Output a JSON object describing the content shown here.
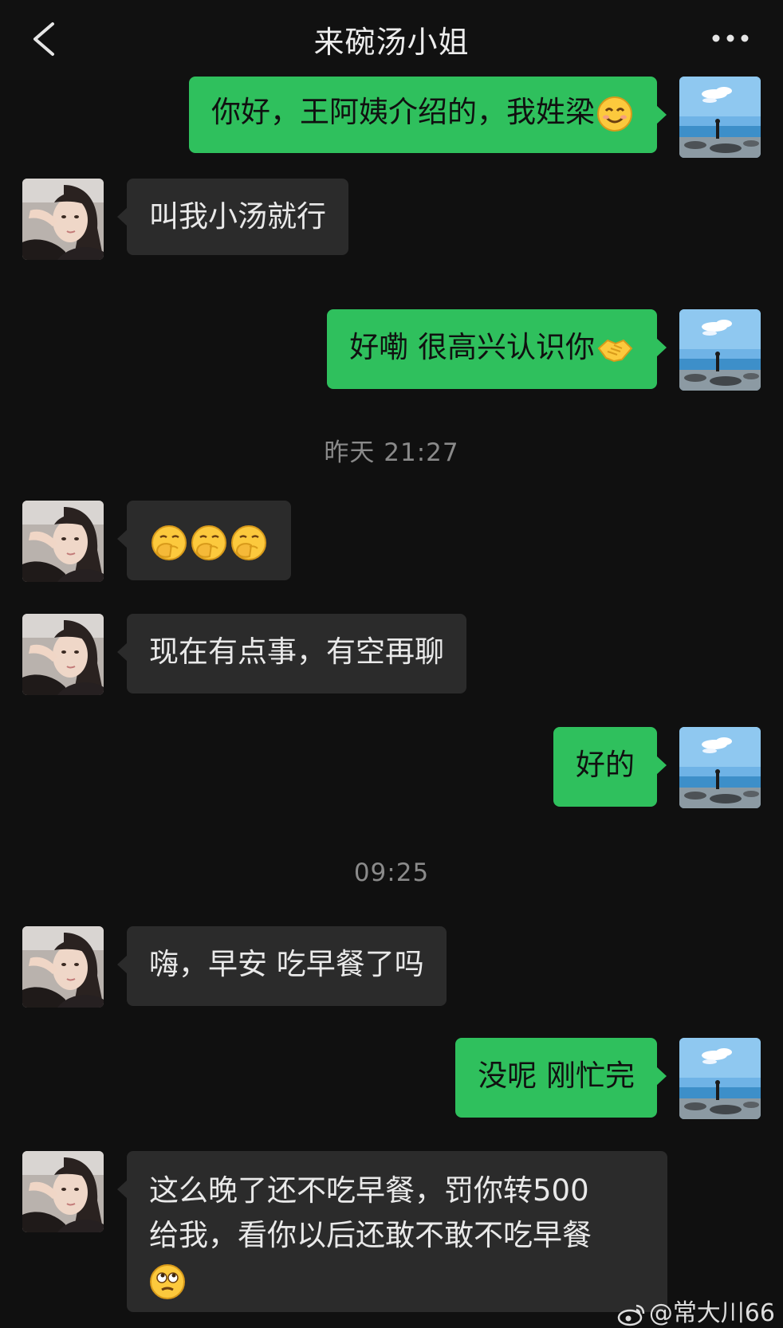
{
  "header": {
    "title": "来碗汤小姐",
    "back_icon": "chevron-left-icon",
    "more_icon": "more-dots-icon"
  },
  "messages": [
    {
      "side": "out",
      "text": "你好，王阿姨介绍的，我姓梁",
      "emoji": "smile-emoji"
    },
    {
      "side": "in",
      "text": "叫我小汤就行"
    },
    {
      "side": "out",
      "text": "好嘞 很高兴认识你",
      "emoji": "handshake-emoji"
    },
    {
      "side": "in",
      "text": "",
      "emoji": "shy-emoji x3"
    },
    {
      "side": "in",
      "text": "现在有点事，有空再聊"
    },
    {
      "side": "out",
      "text": "好的"
    },
    {
      "side": "in",
      "text": "嗨，早安 吃早餐了吗"
    },
    {
      "side": "out",
      "text": "没呢 刚忙完"
    },
    {
      "side": "in",
      "lines": [
        "这么晚了还不吃早餐，罚你转500",
        "给我，看你以后还敢不敢不吃早餐"
      ],
      "emoji": "eye-roll-emoji"
    }
  ],
  "timestamps": [
    "昨天 21:27",
    "09:25"
  ],
  "watermark": "@常大川66",
  "colors": {
    "background": "#101010",
    "incoming_bubble": "#2b2b2b",
    "outgoing_bubble": "#2fc05d",
    "timestamp": "#8a8a8a"
  }
}
